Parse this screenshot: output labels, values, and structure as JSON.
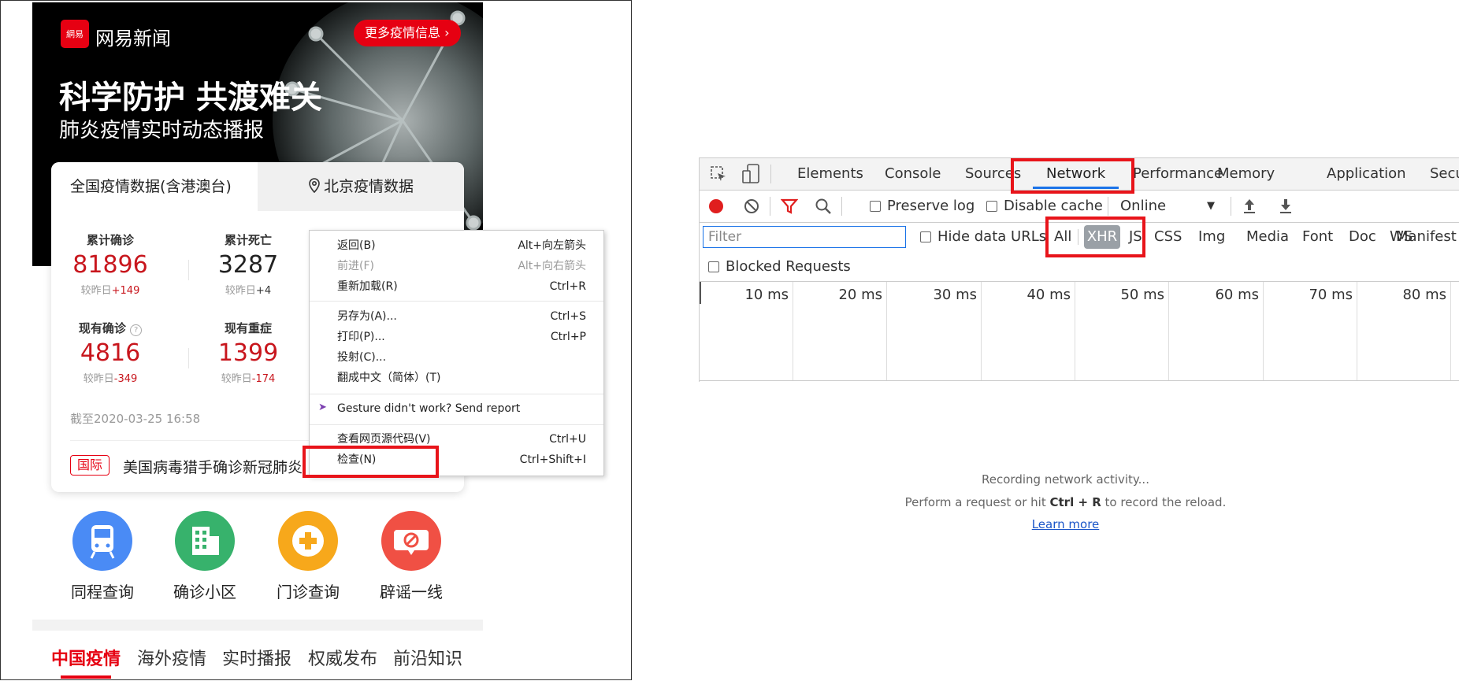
{
  "news": {
    "logo_mark": "網易",
    "logo_text": "网易新闻",
    "more_button": "更多疫情信息",
    "headline": "科学防护 共渡难关",
    "subheadline": "肺炎疫情实时动态播报",
    "tabs": {
      "national": "全国疫情数据(含港澳台)",
      "beijing": "北京疫情数据"
    },
    "stats": [
      {
        "label": "累计确诊",
        "value": "81896",
        "cmp_prefix": "较昨日",
        "cmp": "+149"
      },
      {
        "label": "累计死亡",
        "value": "3287",
        "cmp_prefix": "较昨日",
        "cmp": "+4"
      },
      {
        "label": "现有确诊",
        "value": "4816",
        "cmp_prefix": "较昨日",
        "cmp": "-349"
      },
      {
        "label": "现有重症",
        "value": "1399",
        "cmp_prefix": "较昨日",
        "cmp": "-174"
      }
    ],
    "as_of": "截至2020-03-25 16:58",
    "news_tag": "国际",
    "news_headline": "美国病毒猎手确诊新冠肺炎",
    "services": [
      "同程查询",
      "确诊小区",
      "门诊查询",
      "辟谣一线"
    ],
    "bottom_tabs": [
      "中国疫情",
      "海外疫情",
      "实时播报",
      "权威发布",
      "前沿知识"
    ]
  },
  "context_menu": {
    "items": [
      {
        "label": "返回(B)",
        "shortcut": "Alt+向左箭头"
      },
      {
        "label": "前进(F)",
        "shortcut": "Alt+向右箭头"
      },
      {
        "label": "重新加载(R)",
        "shortcut": "Ctrl+R"
      },
      {
        "label": "另存为(A)...",
        "shortcut": "Ctrl+S"
      },
      {
        "label": "打印(P)...",
        "shortcut": "Ctrl+P"
      },
      {
        "label": "投射(C)...",
        "shortcut": ""
      },
      {
        "label": "翻成中文（简体）(T)",
        "shortcut": ""
      },
      {
        "label": "Gesture didn't work? Send report",
        "shortcut": ""
      },
      {
        "label": "查看网页源代码(V)",
        "shortcut": "Ctrl+U"
      },
      {
        "label": "检查(N)",
        "shortcut": "Ctrl+Shift+I"
      }
    ]
  },
  "devtools": {
    "tabs": [
      "Elements",
      "Console",
      "Sources",
      "Network",
      "Performance",
      "Memory",
      "Application",
      "Secu"
    ],
    "active_tab": "Network",
    "preserve_log": "Preserve log",
    "disable_cache": "Disable cache",
    "throttle": "Online",
    "filter_placeholder": "Filter",
    "hide_data_urls": "Hide data URLs",
    "filter_types": [
      "All",
      "XHR",
      "JS",
      "CSS",
      "Img",
      "Media",
      "Font",
      "Doc",
      "WS",
      "Manifest"
    ],
    "active_filter": "XHR",
    "blocked_requests": "Blocked Requests",
    "timeline_ticks": [
      "10 ms",
      "20 ms",
      "30 ms",
      "40 ms",
      "50 ms",
      "60 ms",
      "70 ms",
      "80 ms"
    ],
    "recording": "Recording network activity...",
    "hint_pre": "Perform a request or hit ",
    "hint_key": "Ctrl + R",
    "hint_post": " to record the reload.",
    "learn_more": "Learn more"
  },
  "colors": {
    "brand_red": "#e60012",
    "highlight_red": "#e8141a",
    "devtools_blue": "#1a73e8"
  }
}
